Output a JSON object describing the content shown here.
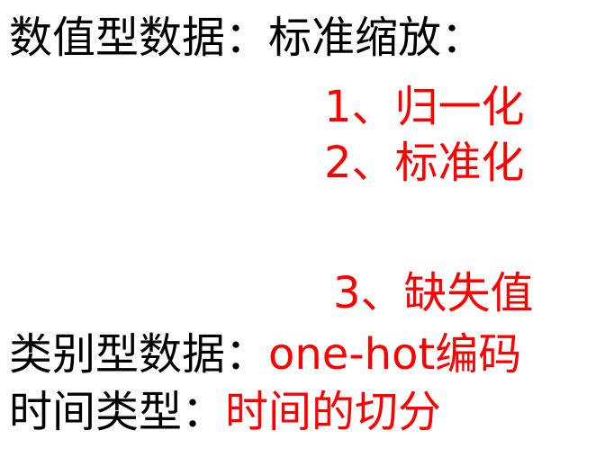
{
  "colors": {
    "text": "#000000",
    "highlight": "#ff0000"
  },
  "lines": {
    "numeric": {
      "label": "数值型数据：",
      "value": "标准缩放："
    },
    "normalize": "1、归一化",
    "standardize": "2、标准化",
    "missing": "3、缺失值",
    "categorical": {
      "label": "类别型数据：",
      "value": "one-hot编码"
    },
    "time": {
      "label": "时间类型：",
      "value": "时间的切分"
    }
  }
}
